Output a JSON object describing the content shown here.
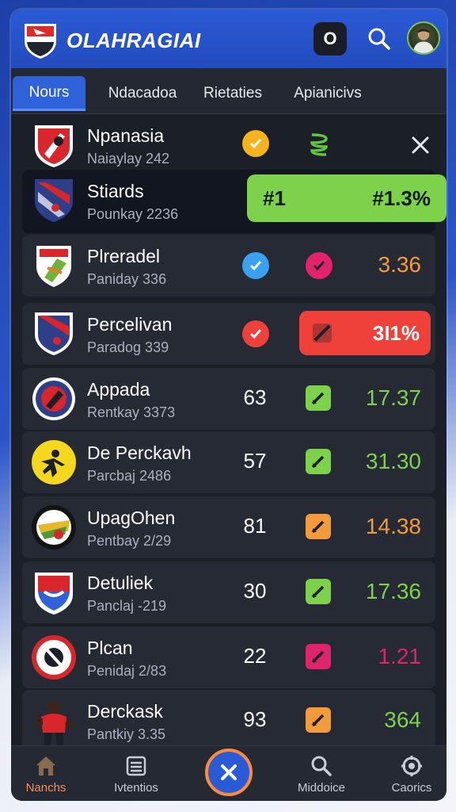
{
  "app": {
    "title": "OLAHRAGIAI"
  },
  "header": {
    "o_button_label": "O"
  },
  "tabs": [
    {
      "label": "Nours"
    },
    {
      "label": "Ndacadoa"
    },
    {
      "label": "Rietaties"
    },
    {
      "label": "Apianicivs"
    }
  ],
  "rows": [
    {
      "name": "Npanasia",
      "sub": "Naiaylay 242"
    },
    {
      "name": "Stiards",
      "sub": "Pounkay 2236",
      "bar_left": "#1",
      "bar_right": "#1.3%",
      "bar_level": 1.0
    },
    {
      "name": "Plreradel",
      "sub": "Paniday 336",
      "value": "3.36"
    },
    {
      "name": "Percelivan",
      "sub": "Paradog 339",
      "value": "3I1%"
    },
    {
      "name": "Appada",
      "sub": "Rentkay 3373",
      "num": "63",
      "value": "17.37"
    },
    {
      "name": "De Perckavh",
      "sub": "Parcbaj 2486",
      "num": "57",
      "value": "31.30"
    },
    {
      "name": "UpagOhen",
      "sub": "Pentbay 2/29",
      "num": "81",
      "value": "14.38"
    },
    {
      "name": "Detuliek",
      "sub": "Panclaj -219",
      "num": "30",
      "value": "17.36"
    },
    {
      "name": "Plcan",
      "sub": "Penidaj 2/83",
      "num": "22",
      "value": "1.21"
    },
    {
      "name": "Derckask",
      "sub": "Pantkiy 3.35",
      "num": "93",
      "value": "364"
    }
  ],
  "nav": [
    {
      "label": "Nanchs"
    },
    {
      "label": "Ivtentios"
    },
    {
      "label": "Middoice"
    },
    {
      "label": "Caorics"
    }
  ],
  "colors": {
    "green": "#7ed14b",
    "orange": "#f39a3a",
    "pink": "#e0236b",
    "red": "#f0403a",
    "accent": "#2a5bd6"
  }
}
